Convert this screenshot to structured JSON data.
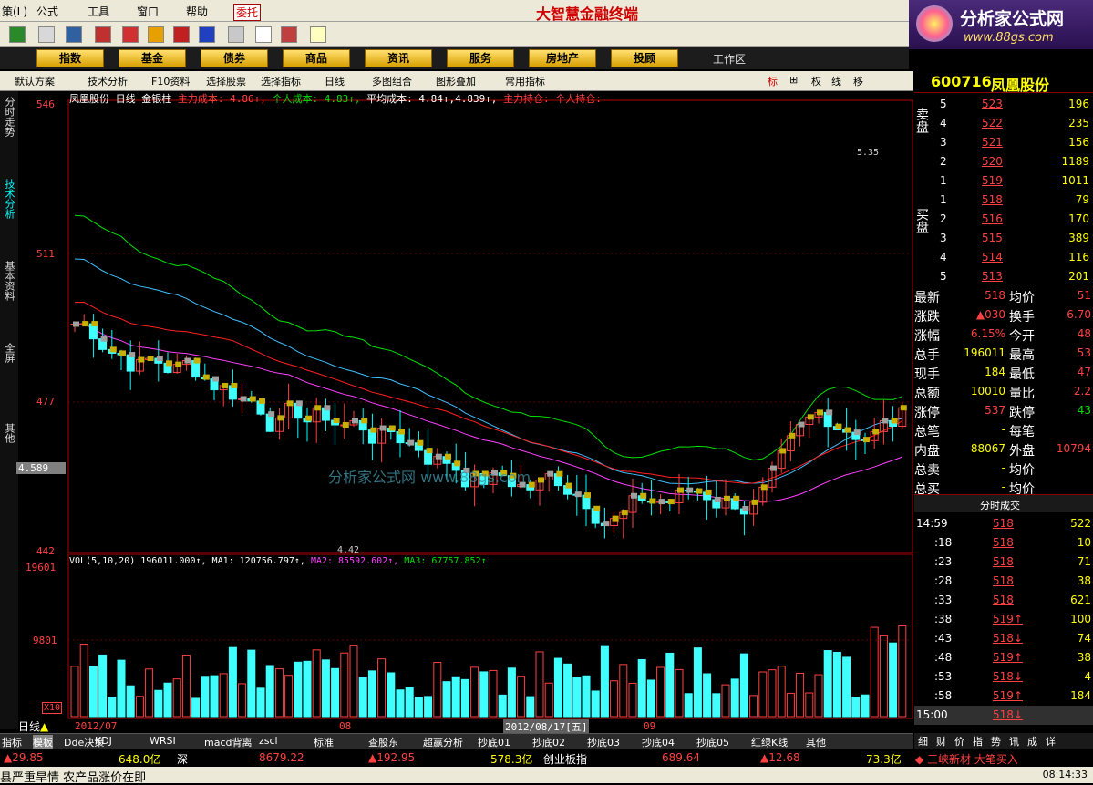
{
  "menu": {
    "items": [
      "策(L)",
      "公式",
      "工具",
      "窗口",
      "帮助",
      "委托"
    ],
    "brand": "大智慧金融终端"
  },
  "logo": {
    "title": "分析家公式网",
    "url": "www.88gs.com"
  },
  "nav": {
    "items": [
      "指数",
      "基金",
      "债券",
      "商品",
      "资讯",
      "服务",
      "房地产",
      "投顾"
    ],
    "workspace": "工作区"
  },
  "subbar": {
    "items": [
      "默认方案",
      "技术分析",
      "F10资料",
      "选择股票",
      "选择指标",
      "日线",
      "多图组合",
      "图形叠加",
      "常用指标"
    ],
    "right": [
      "标",
      "⊞",
      "权",
      "线",
      "移"
    ]
  },
  "rail": [
    "分时走势",
    "技术分析",
    "基本资料",
    "全屏",
    "其他"
  ],
  "chart": {
    "info": "凤凰股份 日线 金银柱",
    "cost1": "主力成本: 4.86↑,",
    "cost2": "个人成本: 4.83↑,",
    "cost3": "平均成本: 4.84↑,4.839↑,",
    "cost4": "主力持仓: 个人持仓:",
    "yt": "546",
    "y1": "511",
    "y2": "477",
    "y3": "442",
    "cur": "4.589",
    "hi": "5.35",
    "lo": "4.42",
    "watermark": "分析家公式网 www.88gs.com",
    "vol": {
      "text": "VOL(5,10,20) 196011.000↑,",
      "ma1": "MA1: 120756.797↑,",
      "ma2": "MA2: 85592.602↑,",
      "ma3": "MA3: 67757.852↑",
      "vt": "19601",
      "vm": "9801",
      "vx": "X10"
    },
    "period": "日线",
    "d1": "2012/07",
    "d2": "08",
    "d3": "2012/08/17[五]",
    "d4": "09"
  },
  "stock": {
    "code": "600716",
    "name": "凤凰股份"
  },
  "sell": [
    [
      "5",
      "523",
      "196"
    ],
    [
      "4",
      "522",
      "235"
    ],
    [
      "3",
      "521",
      "156"
    ],
    [
      "2",
      "520",
      "1189"
    ],
    [
      "1",
      "519",
      "1011"
    ]
  ],
  "buy": [
    [
      "1",
      "518",
      "79"
    ],
    [
      "2",
      "516",
      "170"
    ],
    [
      "3",
      "515",
      "389"
    ],
    [
      "4",
      "514",
      "116"
    ],
    [
      "5",
      "513",
      "201"
    ]
  ],
  "labels": {
    "sell": "卖盘",
    "buy": "买盘",
    "ticks": "分时成交"
  },
  "quote": [
    [
      "最新",
      "518",
      "均价",
      "51"
    ],
    [
      "涨跌",
      "▲030",
      "换手",
      "6.70"
    ],
    [
      "涨幅",
      "6.15%",
      "今开",
      "48"
    ],
    [
      "总手",
      "196011",
      "最高",
      "53"
    ],
    [
      "现手",
      "184",
      "最低",
      "47"
    ],
    [
      "总额",
      "10010",
      "量比",
      "2.2"
    ],
    [
      "涨停",
      "537",
      "跌停",
      "43"
    ],
    [
      "总笔",
      "-",
      "每笔",
      ""
    ],
    [
      "内盘",
      "88067",
      "外盘",
      "10794"
    ],
    [
      "总卖",
      "-",
      "均价",
      ""
    ],
    [
      "总买",
      "-",
      "均价",
      ""
    ]
  ],
  "ticks": [
    [
      "14:59",
      "518",
      "522"
    ],
    [
      ":18",
      "518",
      "10"
    ],
    [
      ":23",
      "518",
      "71"
    ],
    [
      ":28",
      "518",
      "38"
    ],
    [
      ":33",
      "518",
      "621"
    ],
    [
      ":38",
      "519↑",
      "100"
    ],
    [
      ":43",
      "518↓",
      "74"
    ],
    [
      ":48",
      "519↑",
      "38"
    ],
    [
      ":53",
      "518↓",
      "4"
    ],
    [
      ":58",
      "519↑",
      "184"
    ],
    [
      "15:00",
      "518↓",
      ""
    ]
  ],
  "tabs": [
    "指标",
    "模板",
    "Dde决策",
    "KDJ",
    "WRSI",
    "macd背离",
    "zscl",
    "标准",
    "查股东",
    "超赢分析",
    "抄底01",
    "抄底02",
    "抄底03",
    "抄底04",
    "抄底05",
    "红绿K线",
    "其他"
  ],
  "rtabs": [
    "细",
    "财",
    "价",
    "指",
    "势",
    "讯",
    "成",
    "详"
  ],
  "status": [
    "▲29.85",
    "648.0亿",
    "深",
    "8679.22",
    "▲192.95",
    "578.3亿",
    "创业板指",
    "689.64",
    "▲12.68",
    "73.3亿",
    "◆ 三峡新材 大笔买入"
  ],
  "ticker": {
    "text": "县严重旱情 农产品涨价在即",
    "time": "08:14:33"
  },
  "chart_data": {
    "type": "candlestick",
    "ylim": [
      4.42,
      5.46
    ],
    "volmax": 19601
  }
}
